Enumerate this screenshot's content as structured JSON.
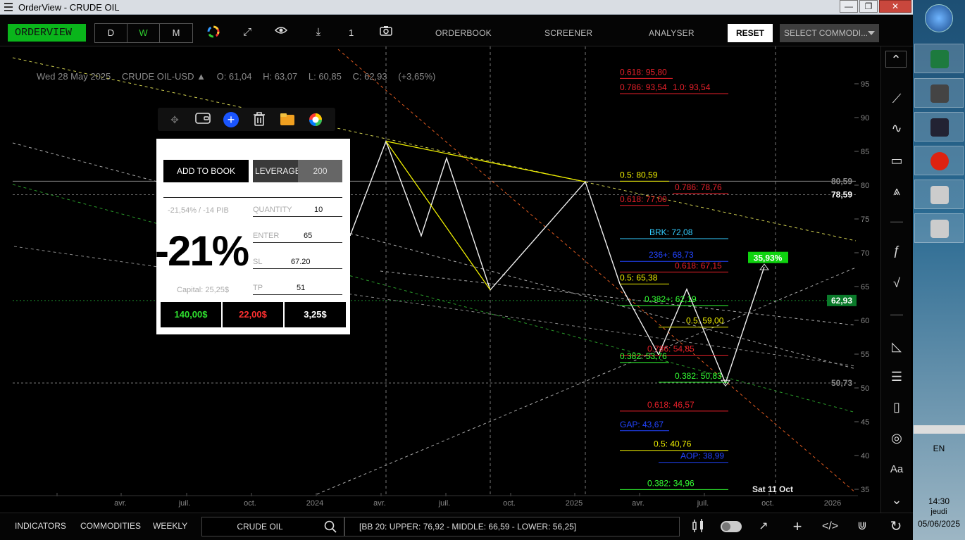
{
  "window": {
    "title": "OrderView - CRUDE OIL",
    "min": "—",
    "max": "❐",
    "close": "✕"
  },
  "toolbar": {
    "orderview_label": "ORDERVIEW",
    "periods": [
      "D",
      "W",
      "M"
    ],
    "active_period": "W",
    "count": "1",
    "links": [
      "ORDERBOOK",
      "SCREENER",
      "ANALYSER"
    ],
    "reset_label": "RESET",
    "select_placeholder": "SELECT COMMODI..."
  },
  "info": {
    "date": "Wed 28 May 2025",
    "symbol": "CRUDE OIL-USD ▲",
    "open": "O: 61,04",
    "high": "H: 63,07",
    "low": "L: 60,85",
    "close": "C: 62,93",
    "change": "(+3,65%)"
  },
  "popup": {
    "add_to_book": "ADD TO BOOK",
    "leverage_label": "LEVERAGE",
    "leverage_value": "200",
    "pct_small": "-21,54%   /   -14 PIB",
    "big_pct": "-21%",
    "capital": "Capital: 25,25$",
    "fields": [
      {
        "label": "QUANTITY",
        "value": "10"
      },
      {
        "label": "ENTER",
        "value": "65"
      },
      {
        "label": "SL",
        "value": "67.20"
      },
      {
        "label": "TP",
        "value": "51"
      }
    ],
    "results": [
      "140,00$",
      "22,00$",
      "3,25$"
    ]
  },
  "chart_data": {
    "type": "line",
    "title": "",
    "ylim": [
      33,
      99
    ],
    "y_ticks": [
      "95",
      "90",
      "85",
      "80",
      "75",
      "70",
      "65",
      "60",
      "55",
      "50",
      "45",
      "40",
      "35"
    ],
    "x_ticks": [
      "avr.",
      "juil.",
      "oct.",
      "2024",
      "avr.",
      "juil.",
      "oct.",
      "2025",
      "avr.",
      "juil.",
      "oct.",
      "2026"
    ],
    "series": [
      {
        "values": [
          72.5,
          86.5,
          72.5,
          84,
          64.5,
          80.5,
          65.4,
          54.9,
          64.6,
          50.7,
          67.9
        ]
      }
    ],
    "price_labels": [
      {
        "text": "80,59",
        "value": 80.59,
        "color": "#888888"
      },
      {
        "text": "78,59",
        "value": 78.59,
        "color": "#ffffff"
      },
      {
        "text": "62,93",
        "value": 62.93,
        "color": "#ffffff",
        "bg": "#0a7a2a"
      },
      {
        "text": "50,73",
        "value": 50.73,
        "color": "#888888"
      }
    ],
    "fib_levels": [
      {
        "text": "0.618: 95,80",
        "value": 95.8,
        "color": "#e8202a"
      },
      {
        "text": "0.786: 93,54",
        "value": 93.54,
        "color": "#e8202a"
      },
      {
        "text": "1.0: 93,54",
        "value": 93.54,
        "color": "#e8202a"
      },
      {
        "text": "0.5: 80,59",
        "value": 80.59,
        "color": "#f0f000"
      },
      {
        "text": "0.786: 78,76",
        "value": 78.76,
        "color": "#e8202a"
      },
      {
        "text": "0.618: 77,00",
        "value": 77.0,
        "color": "#e8202a"
      },
      {
        "text": "BRK: 72,08",
        "value": 72.08,
        "color": "#33ccff"
      },
      {
        "text": "236+: 68,73",
        "value": 68.73,
        "color": "#2244ff"
      },
      {
        "text": "0.618: 67,15",
        "value": 67.15,
        "color": "#e8202a"
      },
      {
        "text": "0.5: 65,38",
        "value": 65.38,
        "color": "#f0f000"
      },
      {
        "text": "0.382+: 62,19",
        "value": 62.19,
        "color": "#33ff33"
      },
      {
        "text": "0.5: 59,00",
        "value": 59.0,
        "color": "#f0f000"
      },
      {
        "text": "0.786: 54,85",
        "value": 54.85,
        "color": "#e8202a"
      },
      {
        "text": "0.382: 53,76",
        "value": 53.76,
        "color": "#33ff33"
      },
      {
        "text": "0.382: 50,83",
        "value": 50.83,
        "color": "#33ff33"
      },
      {
        "text": "0.618: 46,57",
        "value": 46.57,
        "color": "#e8202a"
      },
      {
        "text": "GAP: 43,67",
        "value": 43.67,
        "color": "#2244ff"
      },
      {
        "text": "0.5: 40,76",
        "value": 40.76,
        "color": "#f0f000"
      },
      {
        "text": "AOP: 38,99",
        "value": 38.99,
        "color": "#2244ff"
      },
      {
        "text": "0.382: 34,96",
        "value": 34.96,
        "color": "#33ff33"
      }
    ],
    "target_badge": "35,93%",
    "date_label": "Sat 11 Oct"
  },
  "status": {
    "links": [
      "INDICATORS",
      "COMMODITIES",
      "WEEKLY"
    ],
    "search_value": "CRUDE OIL",
    "bb": "[BB 20:   UPPER:  76,92   -   MIDDLE:  66,59   -   LOWER:  56,25]"
  },
  "taskbar": {
    "lang": "EN",
    "time": "14:30",
    "day": "jeudi",
    "date": "05/06/2025"
  },
  "colors": {
    "green": "#0ab51b",
    "red": "#e8202a",
    "yellow": "#f0f000"
  }
}
